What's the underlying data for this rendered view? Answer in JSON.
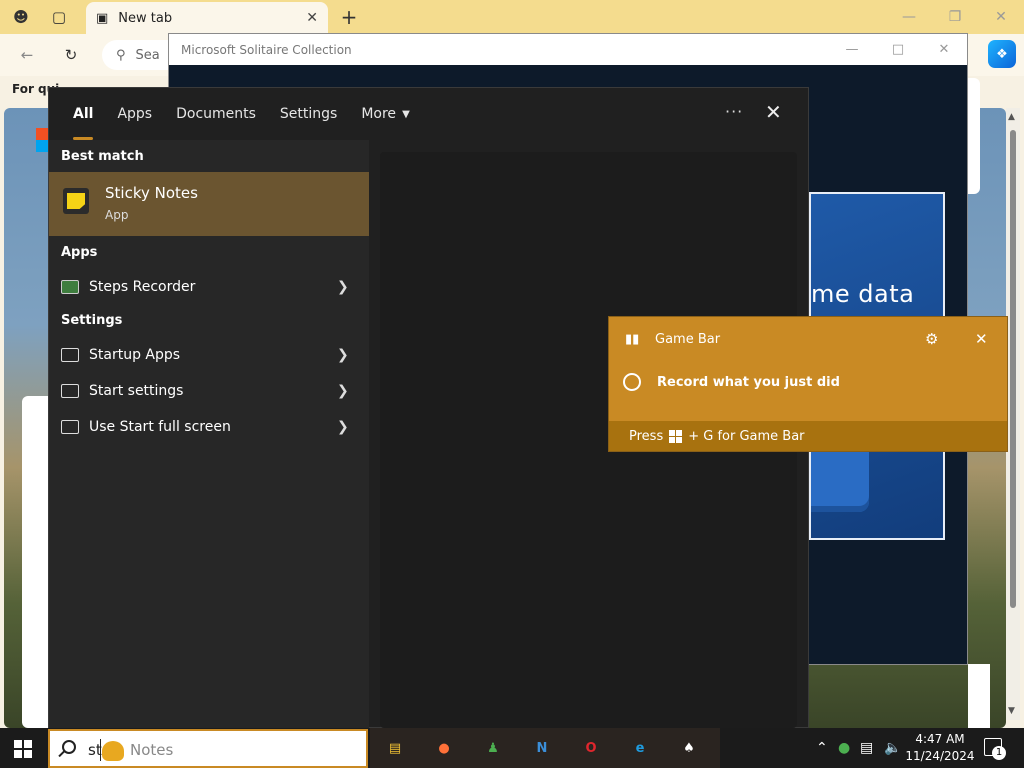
{
  "browser": {
    "tab_title": "New tab",
    "search_placeholder": "Sea",
    "quick_links_label": "For qui"
  },
  "solitaire": {
    "window_title": "Microsoft Solitaire Collection",
    "panel_text": "me data"
  },
  "search": {
    "tabs": [
      "All",
      "Apps",
      "Documents",
      "Settings",
      "More"
    ],
    "active_tab": "All",
    "best_match_heading": "Best match",
    "best_match": {
      "title": "Sticky Notes",
      "subtitle": "App",
      "icon": "sticky-notes-icon"
    },
    "apps_heading": "Apps",
    "apps": [
      {
        "label": "Steps Recorder",
        "icon": "steps-recorder-icon"
      }
    ],
    "settings_heading": "Settings",
    "settings": [
      {
        "label": "Startup Apps",
        "icon": "startup-apps-icon"
      },
      {
        "label": "Start settings",
        "icon": "start-settings-icon"
      },
      {
        "label": "Use Start full screen",
        "icon": "start-fullscreen-icon"
      }
    ]
  },
  "gamebar": {
    "title": "Game Bar",
    "action": "Record what you just did",
    "hint_prefix": "Press",
    "hint_suffix": "+ G for Game Bar"
  },
  "taskbar": {
    "search_typed": "st",
    "search_suggestion": "Notes",
    "apps": [
      {
        "name": "file-explorer-icon",
        "color": "#f2c234"
      },
      {
        "name": "firefox-icon",
        "color": "#ff7139"
      },
      {
        "name": "people-app-icon",
        "color": "#4caf50"
      },
      {
        "name": "n-app-icon",
        "color": "#3b8ed8"
      },
      {
        "name": "opera-icon",
        "color": "#e0262d"
      },
      {
        "name": "edge-icon",
        "color": "#1f9bde"
      },
      {
        "name": "solitaire-icon",
        "color": "#ffffff"
      }
    ],
    "time": "4:47 AM",
    "date": "11/24/2024",
    "notification_count": "1"
  },
  "colors": {
    "accent": "#c98a24",
    "best_match_bg": "#6b5530",
    "flyout_bg": "#202020"
  }
}
